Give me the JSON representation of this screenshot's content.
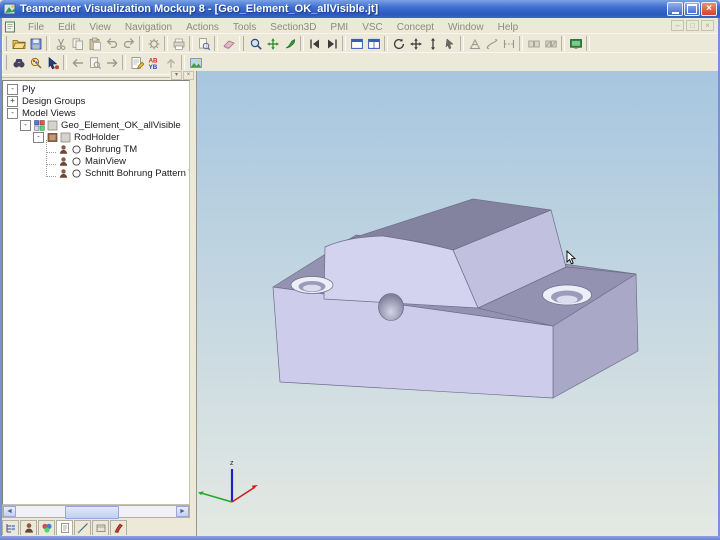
{
  "window": {
    "title": "Teamcenter Visualization Mockup 8  - [Geo_Element_OK_allVisible.jt]",
    "close_glyph": "×",
    "mdi_controls": [
      "–",
      "□",
      "×"
    ]
  },
  "menu": {
    "items": [
      "File",
      "Edit",
      "View",
      "Navigation",
      "Actions",
      "Tools",
      "Section3D",
      "PMI",
      "VSC",
      "Concept",
      "Window",
      "Help"
    ]
  },
  "toolbars": {
    "row1": [
      "handle",
      "open-folder",
      "save",
      "sep",
      "cut",
      "copy",
      "paste",
      "undo",
      "redo",
      "sep",
      "gear",
      "sep",
      "print",
      "sep",
      "page-zoom",
      "sep",
      "eraser",
      "handle",
      "magnifier",
      "walk",
      "fly",
      "sep",
      "first",
      "last",
      "sep",
      "window-blue",
      "window-blue2",
      "sep",
      "rotate",
      "pan",
      "zoom-axis",
      "select-arrow",
      "sep",
      "measure-angle",
      "measure-curve",
      "measure-align",
      "sep",
      "compare",
      "compare2",
      "sep",
      "screen-green",
      "sep"
    ],
    "row2": [
      "handle",
      "binoculars",
      "magnifier-color",
      "pointer-dark",
      "sep",
      "back",
      "find-page",
      "forward",
      "sep",
      "note-edit",
      "ab-yb",
      "up-arrow",
      "sep",
      "image-view"
    ]
  },
  "panel": {
    "header_buttons": [
      {
        "name": "panel-menu-button",
        "glyph": "▾"
      },
      {
        "name": "panel-close-button",
        "glyph": "×"
      }
    ],
    "scrollbar": {
      "left_glyph": "◄",
      "right_glyph": "►"
    },
    "tabs": [
      "tab-tree",
      "tab-user",
      "tab-colors",
      "tab-page",
      "tab-line",
      "tab-box",
      "tab-markup"
    ],
    "tabs_active": 3
  },
  "tree": {
    "rows": [
      {
        "id": "ply",
        "depth": 0,
        "toggle": "-",
        "icons": [],
        "label": "Ply"
      },
      {
        "id": "design-groups",
        "depth": 0,
        "toggle": "+",
        "icons": [],
        "label": "Design Groups"
      },
      {
        "id": "model-views",
        "depth": 0,
        "toggle": "-",
        "icons": [],
        "label": "Model Views"
      },
      {
        "id": "geo-element",
        "depth": 1,
        "toggle": "-",
        "icons": [
          "views-icon",
          "checkbox-icon"
        ],
        "label": "Geo_Element_OK_allVisible"
      },
      {
        "id": "rodholder",
        "depth": 2,
        "toggle": "-",
        "icons": [
          "model-icon",
          "checkbox-icon"
        ],
        "label": "RodHolder"
      },
      {
        "id": "bohrung-tm",
        "depth": 3,
        "toggle": "",
        "icons": [
          "view-icon",
          "radio-icon"
        ],
        "label": "Bohrung TM"
      },
      {
        "id": "mainview",
        "depth": 3,
        "toggle": "",
        "icons": [
          "view-icon",
          "radio-icon"
        ],
        "label": "MainView"
      },
      {
        "id": "schnitt-bohrung",
        "depth": 3,
        "toggle": "",
        "icons": [
          "view-icon",
          "radio-icon"
        ],
        "label": "Schnitt Bohrung Pattern TM"
      }
    ]
  },
  "viewport": {
    "triad": {
      "z_label": "z"
    }
  },
  "colors": {
    "titlebar_blue": "#3f6fd1",
    "toolbar_bg": "#ece9d8",
    "viewport_top": "#a7c6df",
    "viewport_bottom": "#e4e9e3",
    "part_front": "#cdcdeb",
    "part_top": "#8f8fad",
    "part_side": "#a9a9c7",
    "boss_front": "#d3d3f0",
    "boss_side": "#c1c1df",
    "boss_top": "#83839f",
    "flange_top": "#9393b1",
    "hole_rim": "#eeeef8",
    "hole_bore": "#9b9bba",
    "axis_red": "#cc2222",
    "axis_green": "#22aa22",
    "axis_blue": "#2222cc"
  }
}
